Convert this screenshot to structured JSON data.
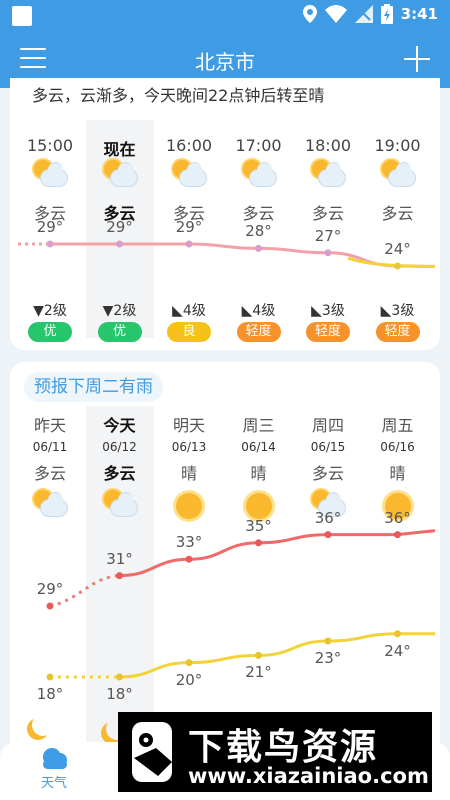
{
  "status_bar": {
    "time": "3:41"
  },
  "header": {
    "title": "北京市",
    "page_count": 2,
    "active_page": 1
  },
  "summary": "多云，云渐多，今天晚间22点钟后转至晴",
  "hourly": [
    {
      "time": "15:00",
      "icon": "partly-cloudy-icon",
      "condition": "多云",
      "temp": "29°",
      "temp_value": 29,
      "wind": "▼2级",
      "wind_dir": "down",
      "aqi": "优",
      "aqi_color": "#27c66d",
      "current": false
    },
    {
      "time": "现在",
      "icon": "partly-cloudy-icon",
      "condition": "多云",
      "temp": "29°",
      "temp_value": 29,
      "wind": "▼2级",
      "wind_dir": "down",
      "aqi": "优",
      "aqi_color": "#27c66d",
      "current": true
    },
    {
      "time": "16:00",
      "icon": "partly-cloudy-icon",
      "condition": "多云",
      "temp": "29°",
      "temp_value": 29,
      "wind": "◣4级",
      "wind_dir": "southwest",
      "aqi": "良",
      "aqi_color": "#f6c21a",
      "current": false
    },
    {
      "time": "17:00",
      "icon": "partly-cloudy-icon",
      "condition": "多云",
      "temp": "28°",
      "temp_value": 28,
      "wind": "◣4级",
      "wind_dir": "southwest",
      "aqi": "轻度",
      "aqi_color": "#f5922c",
      "current": false
    },
    {
      "time": "18:00",
      "icon": "partly-cloudy-icon",
      "condition": "多云",
      "temp": "27°",
      "temp_value": 27,
      "wind": "◣3级",
      "wind_dir": "southwest",
      "aqi": "轻度",
      "aqi_color": "#f5922c",
      "current": false
    },
    {
      "time": "19:00",
      "icon": "partly-cloudy-icon",
      "condition": "多云",
      "temp": "24°",
      "temp_value": 24,
      "wind": "◣3级",
      "wind_dir": "southwest",
      "aqi": "轻度",
      "aqi_color": "#f5922c",
      "current": false
    }
  ],
  "forecast": {
    "tag": "预报下周二有雨",
    "days": [
      {
        "day": "昨天",
        "date": "06/11",
        "condition": "多云",
        "icon": "partly-cloudy-icon",
        "high": "29°",
        "high_value": 29,
        "low": "18°",
        "low_value": 18,
        "today": false
      },
      {
        "day": "今天",
        "date": "06/12",
        "condition": "多云",
        "icon": "partly-cloudy-icon",
        "high": "31°",
        "high_value": 31,
        "low": "18°",
        "low_value": 18,
        "today": true
      },
      {
        "day": "明天",
        "date": "06/13",
        "condition": "晴",
        "icon": "sunny-icon",
        "high": "33°",
        "high_value": 33,
        "low": "20°",
        "low_value": 20,
        "today": false
      },
      {
        "day": "周三",
        "date": "06/14",
        "condition": "晴",
        "icon": "sunny-icon",
        "high": "35°",
        "high_value": 35,
        "low": "21°",
        "low_value": 21,
        "today": false
      },
      {
        "day": "周四",
        "date": "06/15",
        "condition": "多云",
        "icon": "partly-cloudy-icon",
        "high": "36°",
        "high_value": 36,
        "low": "23°",
        "low_value": 23,
        "today": false
      },
      {
        "day": "周五",
        "date": "06/16",
        "condition": "晴",
        "icon": "sunny-icon",
        "high": "36°",
        "high_value": 36,
        "low": "24°",
        "low_value": 24,
        "today": false
      }
    ]
  },
  "bottom_nav": {
    "weather_label": "天气",
    "weather_icon": "weather-cloud-icon"
  },
  "watermark": {
    "title": "下载鸟资源",
    "url": "www.xiazainiao.com"
  },
  "colors": {
    "primary": "#3f9be3",
    "high_line": "#f06a6a",
    "low_line": "#f2d33a"
  }
}
